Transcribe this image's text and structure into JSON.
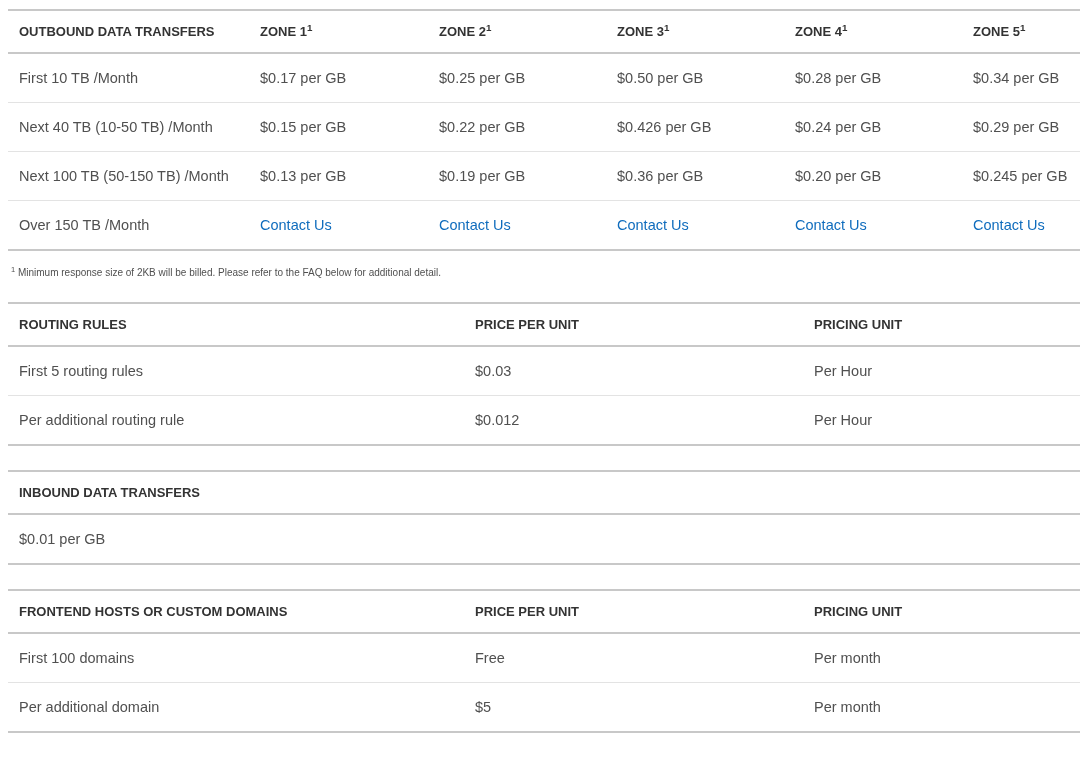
{
  "outbound_table": {
    "columns": [
      "OUTBOUND DATA TRANSFERS",
      "ZONE 1$^{1}$",
      "ZONE 2$^{1}$",
      "ZONE 3$^{1}$",
      "ZONE 4$^{1}$",
      "ZONE 5$^{1}$"
    ],
    "rows": [
      [
        {
          "kind": "text",
          "text": "First 10 TB /Month"
        },
        {
          "kind": "text",
          "text": "$0.17 per GB"
        },
        {
          "kind": "text",
          "text": "$0.25 per GB"
        },
        {
          "kind": "text",
          "text": "$0.50 per GB"
        },
        {
          "kind": "text",
          "text": "$0.28 per GB"
        },
        {
          "kind": "text",
          "text": "$0.34 per GB"
        }
      ],
      [
        {
          "kind": "text",
          "text": "Next 40 TB (10-50 TB) /Month"
        },
        {
          "kind": "text",
          "text": "$0.15 per GB"
        },
        {
          "kind": "text",
          "text": "$0.22 per GB"
        },
        {
          "kind": "text",
          "text": "$0.426 per GB"
        },
        {
          "kind": "text",
          "text": "$0.24 per GB"
        },
        {
          "kind": "text",
          "text": "$0.29 per GB"
        }
      ],
      [
        {
          "kind": "text",
          "text": "Next 100 TB (50-150 TB) /Month"
        },
        {
          "kind": "text",
          "text": "$0.13 per GB"
        },
        {
          "kind": "text",
          "text": "$0.19 per GB"
        },
        {
          "kind": "text",
          "text": "$0.36 per GB"
        },
        {
          "kind": "text",
          "text": "$0.20 per GB"
        },
        {
          "kind": "text",
          "text": "$0.245 per GB"
        }
      ],
      [
        {
          "kind": "text",
          "text": "Over 150 TB /Month"
        },
        {
          "kind": "link",
          "text": "Contact Us"
        },
        {
          "kind": "link",
          "text": "Contact Us"
        },
        {
          "kind": "link",
          "text": "Contact Us"
        },
        {
          "kind": "link",
          "text": "Contact Us"
        },
        {
          "kind": "link",
          "text": "Contact Us"
        }
      ]
    ]
  },
  "footnote": "$^{1}$ Minimum response size of 2KB will be billed. Please refer to the FAQ below for additional detail.",
  "routing_table": {
    "columns": [
      "ROUTING RULES",
      "PRICE PER UNIT",
      "PRICING UNIT"
    ],
    "rows": [
      [
        {
          "kind": "text",
          "text": "First 5 routing rules"
        },
        {
          "kind": "text",
          "text": "$0.03"
        },
        {
          "kind": "text",
          "text": "Per Hour"
        }
      ],
      [
        {
          "kind": "text",
          "text": "Per additional routing rule"
        },
        {
          "kind": "text",
          "text": "$0.012"
        },
        {
          "kind": "text",
          "text": "Per Hour"
        }
      ]
    ]
  },
  "inbound_table": {
    "columns": [
      "INBOUND DATA TRANSFERS"
    ],
    "rows": [
      [
        {
          "kind": "text",
          "text": "$0.01 per GB"
        }
      ]
    ]
  },
  "frontend_table": {
    "columns": [
      "FRONTEND HOSTS OR CUSTOM DOMAINS",
      "PRICE PER UNIT",
      "PRICING UNIT"
    ],
    "rows": [
      [
        {
          "kind": "text",
          "text": "First 100 domains"
        },
        {
          "kind": "text",
          "text": "Free"
        },
        {
          "kind": "text",
          "text": "Per month"
        }
      ],
      [
        {
          "kind": "text",
          "text": "Per additional domain"
        },
        {
          "kind": "text",
          "text": "$5"
        },
        {
          "kind": "text",
          "text": "Per month"
        }
      ]
    ]
  }
}
